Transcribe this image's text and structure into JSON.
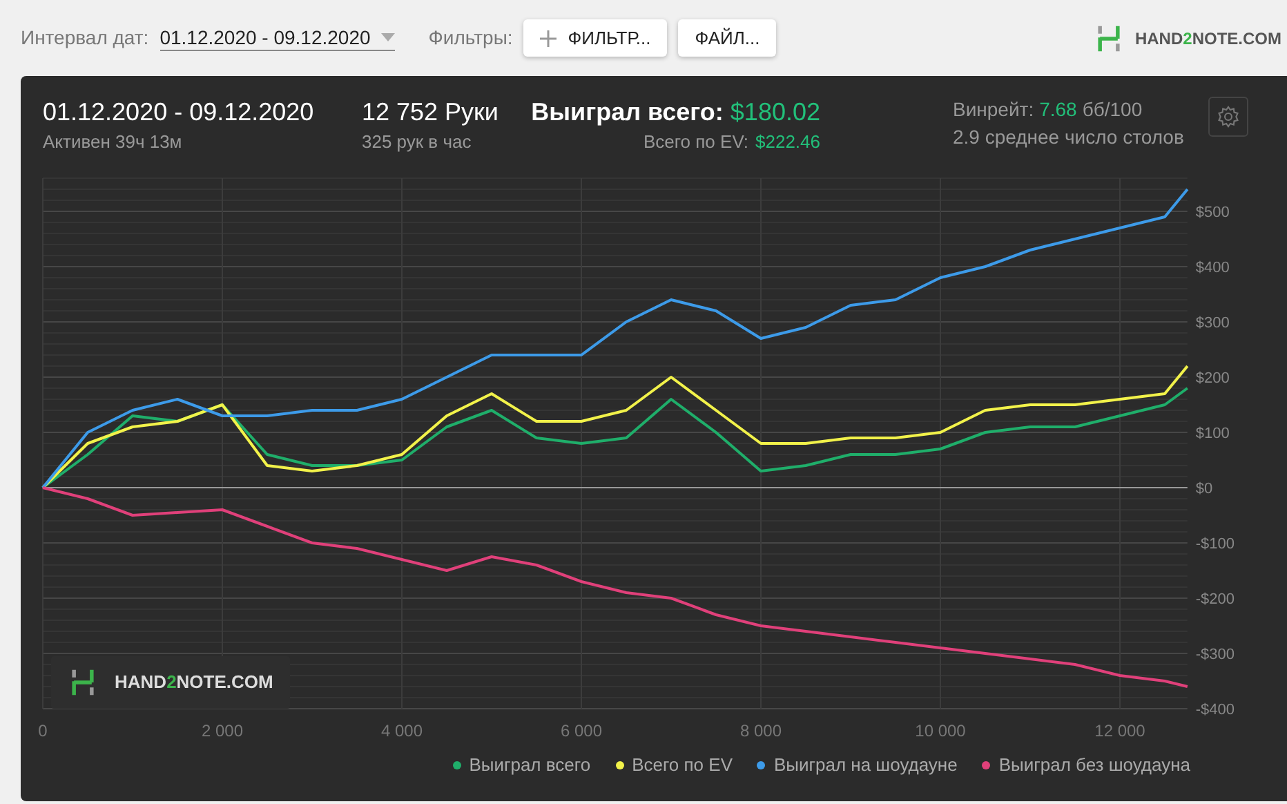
{
  "toolbar": {
    "date_label": "Интервал дат:",
    "date_range": "01.12.2020 - 09.12.2020",
    "filters_label": "Фильтры:",
    "buttons": [
      {
        "label": "ФИЛЬТР...",
        "kind": "add"
      },
      {
        "label": "ФАЙЛ..."
      }
    ]
  },
  "logo": {
    "before": "HAND",
    "accent": "2",
    "after": "NOTE.COM"
  },
  "summary": {
    "period": "01.12.2020 - 09.12.2020",
    "active": "Активен 39ч 13м",
    "hands": "12 752 Руки",
    "hands_per_hour": "325 рук в час",
    "won_label": "Выиграл всего:",
    "won_value": "$180.02",
    "ev_label": "Всего по EV:",
    "ev_value": "$222.46",
    "winrate_label": "Винрейт:",
    "winrate_value": "7.68",
    "winrate_unit": "бб/100",
    "tables": "2.9 среднее число столов"
  },
  "chart": {
    "watermark": {
      "before": "HAND",
      "accent": "2",
      "after": "NOTE.COM"
    },
    "chart_data": {
      "type": "line",
      "grid": true,
      "x": [
        0,
        500,
        1000,
        1500,
        2000,
        2500,
        3000,
        3500,
        4000,
        4500,
        5000,
        5500,
        6000,
        6500,
        7000,
        7500,
        8000,
        8500,
        9000,
        9500,
        10000,
        10500,
        11000,
        11500,
        12000,
        12500,
        12752
      ],
      "series": [
        {
          "name": "Выиграл всего",
          "color": "#1fae6a",
          "values": [
            0,
            60,
            130,
            120,
            150,
            60,
            40,
            40,
            50,
            110,
            140,
            90,
            80,
            90,
            160,
            100,
            30,
            40,
            60,
            60,
            70,
            100,
            110,
            110,
            130,
            150,
            180
          ]
        },
        {
          "name": "Всего по EV",
          "color": "#f2f24a",
          "values": [
            0,
            80,
            110,
            120,
            150,
            40,
            30,
            40,
            60,
            130,
            170,
            120,
            120,
            140,
            200,
            140,
            80,
            80,
            90,
            90,
            100,
            140,
            150,
            150,
            160,
            170,
            220
          ]
        },
        {
          "name": "Выиграл на шоудауне",
          "color": "#3d9be9",
          "values": [
            0,
            100,
            140,
            160,
            130,
            130,
            140,
            140,
            160,
            200,
            240,
            240,
            240,
            300,
            340,
            320,
            270,
            290,
            330,
            340,
            380,
            400,
            430,
            450,
            470,
            490,
            540
          ]
        },
        {
          "name": "Выиграл без шоудауна",
          "color": "#e0407a",
          "values": [
            0,
            -20,
            -50,
            -45,
            -40,
            -70,
            -100,
            -110,
            -130,
            -150,
            -125,
            -140,
            -170,
            -190,
            -200,
            -230,
            -250,
            -260,
            -270,
            -280,
            -290,
            -300,
            -310,
            -320,
            -340,
            -350,
            -360
          ]
        }
      ],
      "xlim": [
        0,
        12752
      ],
      "ylim": [
        -400,
        560
      ],
      "xticks": [
        {
          "value": 0,
          "label": "0"
        },
        {
          "value": 2000,
          "label": "2 000"
        },
        {
          "value": 4000,
          "label": "4 000"
        },
        {
          "value": 6000,
          "label": "6 000"
        },
        {
          "value": 8000,
          "label": "8 000"
        },
        {
          "value": 10000,
          "label": "10 000"
        },
        {
          "value": 12000,
          "label": "12 000"
        }
      ],
      "yticks": [
        {
          "value": 500,
          "label": "$500"
        },
        {
          "value": 400,
          "label": "$400"
        },
        {
          "value": 300,
          "label": "$300"
        },
        {
          "value": 200,
          "label": "$200"
        },
        {
          "value": 100,
          "label": "$100"
        },
        {
          "value": 0,
          "label": "$0"
        },
        {
          "value": -100,
          "label": "-$100"
        },
        {
          "value": -200,
          "label": "-$200"
        },
        {
          "value": -300,
          "label": "-$300"
        },
        {
          "value": -400,
          "label": "-$400"
        }
      ]
    }
  }
}
